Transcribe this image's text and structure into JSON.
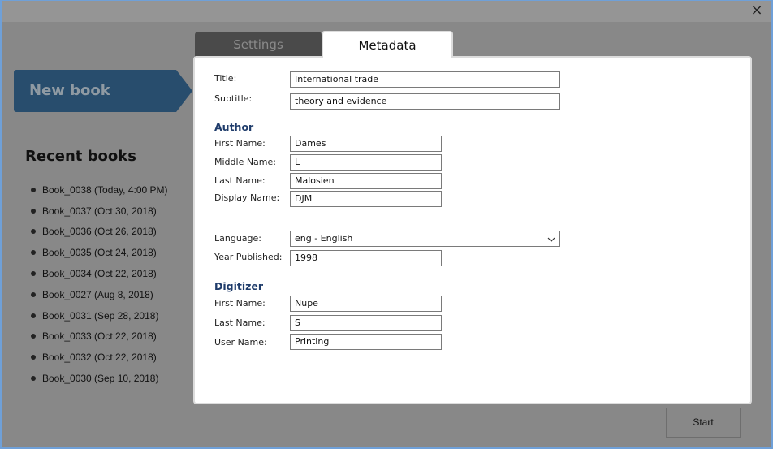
{
  "window": {
    "close_icon": "×"
  },
  "sidebar": {
    "new_book_label": "New book",
    "recent_title": "Recent books",
    "recent_books": [
      "Book_0038 (Today, 4:00 PM)",
      "Book_0037 (Oct 30, 2018)",
      "Book_0036 (Oct 26, 2018)",
      "Book_0035 (Oct 24, 2018)",
      "Book_0034 (Oct 22, 2018)",
      "Book_0027 (Aug 8, 2018)",
      "Book_0031 (Sep 28, 2018)",
      "Book_0033 (Oct 22, 2018)",
      "Book_0032 (Oct 22, 2018)",
      "Book_0030 (Sep 10, 2018)"
    ]
  },
  "tabs": {
    "settings": "Settings",
    "metadata": "Metadata",
    "active": "Metadata"
  },
  "metadata": {
    "title_label": "Title:",
    "title_value": "International trade",
    "subtitle_label": "Subtitle:",
    "subtitle_value": "theory and evidence",
    "author_heading": "Author",
    "author": {
      "first_name_label": "First Name:",
      "first_name": "Dames",
      "middle_name_label": "Middle Name:",
      "middle_name": "L",
      "last_name_label": "Last Name:",
      "last_name": "Malosien",
      "display_name_label": "Display Name:",
      "display_name": "DJM"
    },
    "language_label": "Language:",
    "language_value": "eng - English",
    "chevron": "⌵",
    "year_label": "Year Published:",
    "year_value": "1998",
    "digitizer_heading": "Digitizer",
    "digitizer": {
      "first_name_label": "First Name:",
      "first_name": "Nupe",
      "last_name_label": "Last Name:",
      "last_name": "S",
      "user_name_label": "User Name:",
      "user_name": "Printing"
    }
  },
  "footer": {
    "start_label": "Start"
  },
  "colors": {
    "accent_blue": "#284d6d",
    "section_heading": "#1f3c6b",
    "window_border": "#6fa0d8"
  }
}
